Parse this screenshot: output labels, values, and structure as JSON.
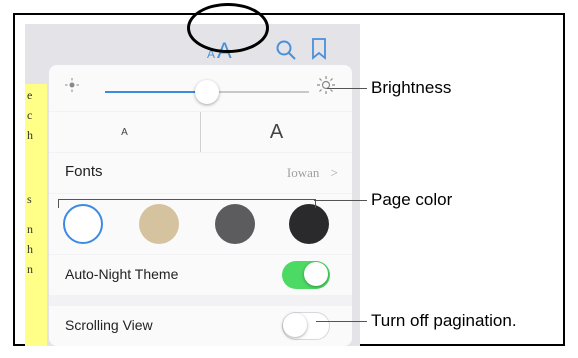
{
  "toolbar": {
    "text_size_icon": "aA-icon",
    "text_size_label_small": "A",
    "text_size_label_large": "A",
    "search_icon": "search-icon",
    "bookmark_icon": "bookmark-icon"
  },
  "book_page_glimpse": [
    "e",
    "c",
    "h",
    "s",
    "n",
    "h",
    "n"
  ],
  "settings": {
    "brightness": {
      "icon_low": "sun-small-icon",
      "icon_high": "sun-large-icon",
      "level": 0.42
    },
    "font_size": {
      "smaller_label": "A",
      "larger_label": "A"
    },
    "fonts": {
      "label": "Fonts",
      "value": "Iowan",
      "chevron": ">"
    },
    "page_colors": [
      {
        "name": "white",
        "color": "#ffffff",
        "selected": true
      },
      {
        "name": "sepia",
        "color": "#d5c29e",
        "selected": false
      },
      {
        "name": "gray",
        "color": "#5c5c5e",
        "selected": false
      },
      {
        "name": "night",
        "color": "#2a2a2c",
        "selected": false
      }
    ],
    "auto_night_theme": {
      "label": "Auto-Night Theme",
      "on": true
    },
    "scrolling_view": {
      "label": "Scrolling View",
      "on": false
    }
  },
  "annotations": {
    "brightness": "Brightness",
    "page_color": "Page color",
    "scrolling": "Turn off pagination."
  },
  "colors": {
    "accent_blue": "#3d8ae3",
    "toggle_green": "#4cd964",
    "selected_ring": "#3d8ae3"
  }
}
